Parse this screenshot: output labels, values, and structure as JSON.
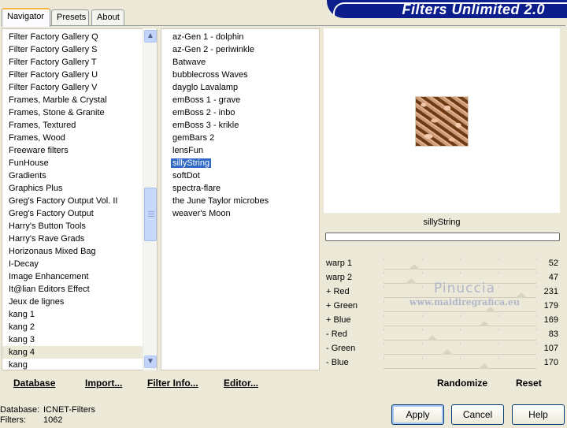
{
  "tabs": [
    {
      "label": "Navigator",
      "active": true
    },
    {
      "label": "Presets",
      "active": false
    },
    {
      "label": "About",
      "active": false
    }
  ],
  "banner_title": "Filters Unlimited 2.0",
  "categories": [
    "Filter Factory Gallery Q",
    "Filter Factory Gallery S",
    "Filter Factory Gallery T",
    "Filter Factory Gallery U",
    "Filter Factory Gallery V",
    "Frames, Marble & Crystal",
    "Frames, Stone & Granite",
    "Frames, Textured",
    "Frames, Wood",
    "Freeware filters",
    "FunHouse",
    "Gradients",
    "Graphics Plus",
    "Greg's Factory Output Vol. II",
    "Greg's Factory Output",
    "Harry's Button Tools",
    "Harry's Rave Grads",
    "Horizonaus Mixed Bag",
    "I-Decay",
    "Image Enhancement",
    "It@lian Editors Effect",
    "Jeux de lignes",
    "kang 1",
    "kang 2",
    "kang 3",
    "kang 4",
    "kang"
  ],
  "selected_category": "kang 4",
  "filters": [
    "az-Gen 1  -  dolphin",
    "az-Gen 2  -  periwinkle",
    "Batwave",
    "bubblecross Waves",
    "dayglo Lavalamp",
    "emBoss 1  -  grave",
    "emBoss 2  -  inbo",
    "emBoss 3  -  krikle",
    "gemBars 2",
    "lensFun",
    "sillyString",
    "softDot",
    "spectra-flare",
    "the June Taylor microbes",
    "weaver's Moon"
  ],
  "selected_filter": "sillyString",
  "preview_filter_name": "sillyString",
  "sliders": [
    {
      "label": "warp 1",
      "value": "52",
      "fraction": 0.2
    },
    {
      "label": "warp 2",
      "value": "47",
      "fraction": 0.18
    },
    {
      "label": "+ Red",
      "value": "231",
      "fraction": 0.9
    },
    {
      "label": "+ Green",
      "value": "179",
      "fraction": 0.7
    },
    {
      "label": "+ Blue",
      "value": "169",
      "fraction": 0.66
    },
    {
      "label": "- Red",
      "value": "83",
      "fraction": 0.32
    },
    {
      "label": "- Green",
      "value": "107",
      "fraction": 0.42
    },
    {
      "label": "- Blue",
      "value": "170",
      "fraction": 0.66
    }
  ],
  "watermark": {
    "name": "Pinuccia",
    "site": "www.maidiregrafica.eu"
  },
  "actions": {
    "database": "Database",
    "import": "Import...",
    "filter_info": "Filter Info...",
    "editor": "Editor...",
    "randomize": "Randomize",
    "reset": "Reset"
  },
  "info": {
    "database_label": "Database:",
    "database_value": "ICNET-Filters",
    "filters_label": "Filters:",
    "filters_value": "1062"
  },
  "buttons": {
    "apply": "Apply",
    "cancel": "Cancel",
    "help": "Help"
  },
  "scroll_icons": {
    "up": "▲",
    "down": "▼"
  }
}
